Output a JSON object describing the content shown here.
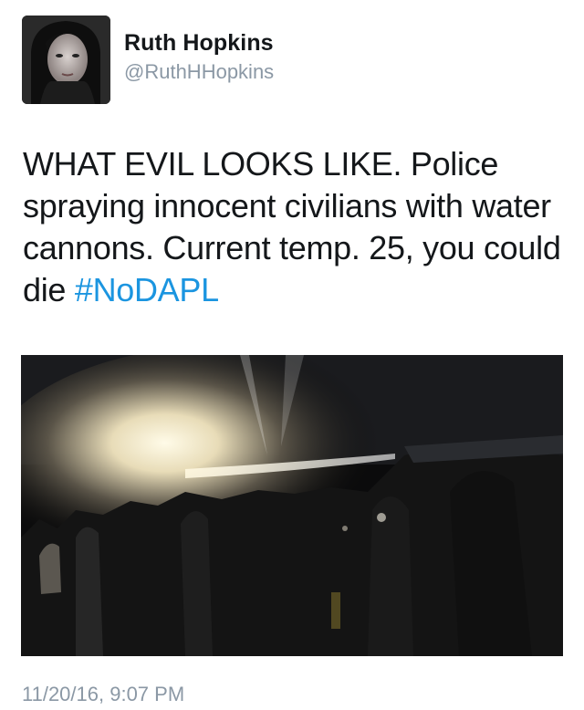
{
  "tweet": {
    "author_name": "Ruth Hopkins",
    "author_handle": "@RuthHHopkins",
    "text": "WHAT EVIL LOOKS LIKE. Police spraying innocent civilians with water cannons. Current temp. 25, you could die ",
    "hashtag": "#NoDAPL",
    "timestamp": "11/20/16, 9:07 PM"
  },
  "colors": {
    "text": "#14171a",
    "secondary": "#8b98a5",
    "link": "#1b95e0"
  },
  "icons": {
    "avatar": "profile-photo",
    "media": "night-photo-water-cannon"
  }
}
